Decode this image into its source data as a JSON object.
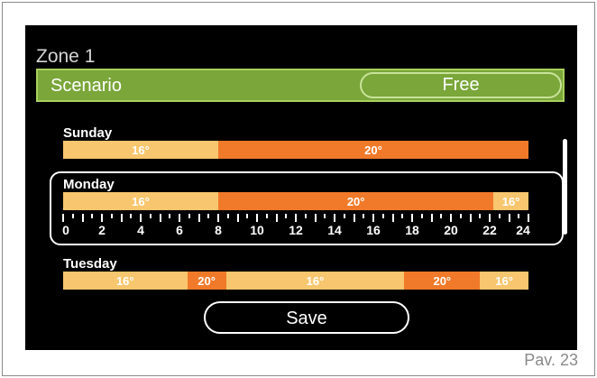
{
  "zone": {
    "title": "Zone 1"
  },
  "scenario": {
    "label": "Scenario",
    "value": "Free"
  },
  "days": [
    {
      "name": "Sunday",
      "segments": [
        {
          "from": 0,
          "to": 8,
          "temp": "16°",
          "level": "low"
        },
        {
          "from": 8,
          "to": 24,
          "temp": "20°",
          "level": "high"
        }
      ]
    },
    {
      "name": "Monday",
      "selected": true,
      "segments": [
        {
          "from": 0,
          "to": 8,
          "temp": "16°",
          "level": "low"
        },
        {
          "from": 8,
          "to": 22.2,
          "temp": "20°",
          "level": "high"
        },
        {
          "from": 22.2,
          "to": 24,
          "temp": "16°",
          "level": "low"
        }
      ]
    },
    {
      "name": "Tuesday",
      "segments": [
        {
          "from": 0,
          "to": 6.4,
          "temp": "16°",
          "level": "low"
        },
        {
          "from": 6.4,
          "to": 8.4,
          "temp": "20°",
          "level": "high"
        },
        {
          "from": 8.4,
          "to": 17.6,
          "temp": "16°",
          "level": "low"
        },
        {
          "from": 17.6,
          "to": 21.5,
          "temp": "20°",
          "level": "high"
        },
        {
          "from": 21.5,
          "to": 24,
          "temp": "16°",
          "level": "low"
        }
      ]
    }
  ],
  "timeline": {
    "labels": [
      "0",
      "2",
      "4",
      "6",
      "8",
      "10",
      "12",
      "14",
      "16",
      "18",
      "20",
      "22",
      "24"
    ]
  },
  "save": {
    "label": "Save"
  },
  "page": {
    "ref": "Pav. 23"
  },
  "colors": {
    "low": "#f8c66e",
    "high": "#f07a2a",
    "scenario": "#7aa63a",
    "screen": "#000000"
  }
}
